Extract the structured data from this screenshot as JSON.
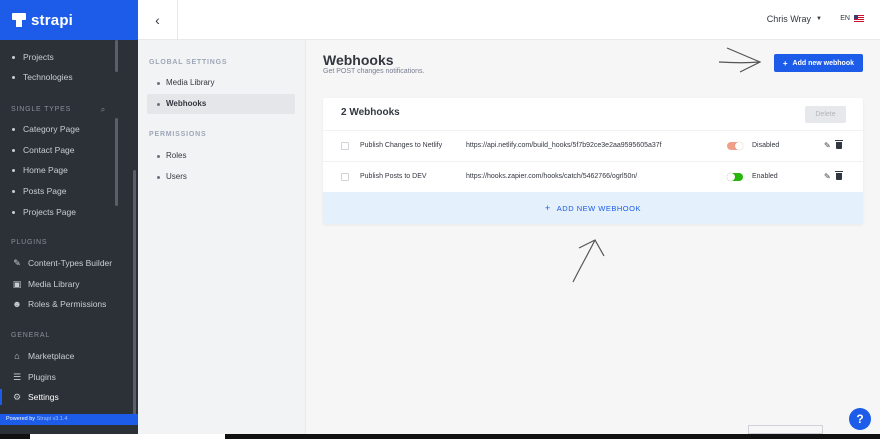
{
  "brand": {
    "name": "strapi"
  },
  "sidebar": {
    "top_items": [
      "Projects",
      "Technologies"
    ],
    "single_types_title": "SINGLE TYPES",
    "single_types": [
      "Category Page",
      "Contact Page",
      "Home Page",
      "Posts Page",
      "Projects Page"
    ],
    "plugins_title": "PLUGINS",
    "plugins": [
      "Content-Types Builder",
      "Media Library",
      "Roles & Permissions"
    ],
    "general_title": "GENERAL",
    "general": [
      "Marketplace",
      "Plugins",
      "Settings"
    ],
    "footer_prefix": "Powered by",
    "footer_link": "Strapi v3.1.4"
  },
  "header": {
    "user": "Chris Wray",
    "lang": "EN"
  },
  "subnav": {
    "global_title": "GLOBAL SETTINGS",
    "global_items": [
      "Media Library",
      "Webhooks"
    ],
    "permissions_title": "PERMISSIONS",
    "permissions_items": [
      "Roles",
      "Users"
    ]
  },
  "main": {
    "title": "Webhooks",
    "subtitle": "Get POST changes notifications.",
    "add_button": "Add new webhook",
    "list_title": "2 Webhooks",
    "delete_button": "Delete",
    "rows": [
      {
        "name": "Publish Changes to Netlify",
        "url": "https://api.netlify.com/build_hooks/5f7b92ce3e2aa9595605a37f",
        "status": "Disabled",
        "enabled": false
      },
      {
        "name": "Publish Posts to DEV",
        "url": "https://hooks.zapier.com/hooks/catch/5462766/ogrl50n/",
        "status": "Enabled",
        "enabled": true
      }
    ],
    "add_row_label": "ADD NEW WEBHOOK"
  },
  "help": {
    "label": "?"
  },
  "colors": {
    "primary": "#1c5ce8",
    "sidebar": "#2c3138",
    "enabled": "#27b70a",
    "disabled": "#f0a08a"
  }
}
